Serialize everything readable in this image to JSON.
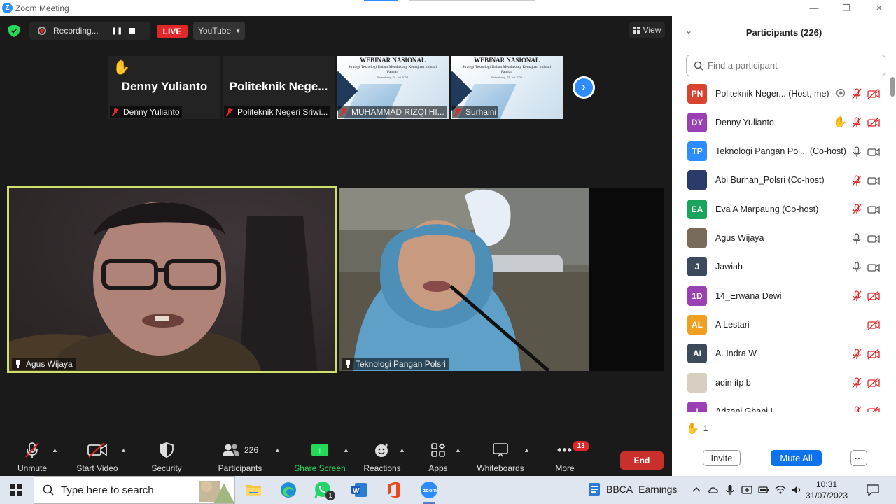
{
  "window": {
    "title": "Zoom Meeting",
    "logo_letter": "Z",
    "minimize": "—",
    "maximize": "❐",
    "close": "✕"
  },
  "topbar": {
    "recording_label": "Recording...",
    "pause_label": "❚❚",
    "live_label": "LIVE",
    "stream_target": "YouTube",
    "view_label": "View"
  },
  "thumbnails": [
    {
      "display_name": "Denny Yulianto",
      "label": "Denny Yulianto",
      "raised_hand": true
    },
    {
      "display_name": "Politeknik  Nege...",
      "label": "Politeknik Negeri Sriwi..."
    },
    {
      "label": "MUHAMMAD RIZQI HI...",
      "slide_title": "WEBINAR NASIONAL",
      "slide_subtitle": "Strategi Teknologi Dalam Mendukung Kemajuan Industri Pangan",
      "slide_date": "Palembang, 31 Juli 2023"
    },
    {
      "label": "Surhaini",
      "slide_title": "WEBINAR NASIONAL",
      "slide_subtitle": "Strategi Teknologi Dalam Mendukung Kemajuan Industri Pangan",
      "slide_date": "Palembang, 31 Juli 2023"
    }
  ],
  "next_arrow": "›",
  "main_videos": [
    {
      "name": "Agus Wijaya"
    },
    {
      "name": "Teknologi Pangan Polsri"
    }
  ],
  "toolbar": {
    "unmute": "Unmute",
    "start_video": "Start Video",
    "security": "Security",
    "participants": "Participants",
    "participants_count": "226",
    "share_screen": "Share Screen",
    "reactions": "Reactions",
    "apps": "Apps",
    "whiteboards": "Whiteboards",
    "more": "More",
    "more_badge": "13",
    "end": "End"
  },
  "panel": {
    "title": "Participants (226)",
    "search_placeholder": "Find a participant",
    "participants": [
      {
        "initials": "PN",
        "color": "#d9432f",
        "name": "Politeknik Neger... (Host, me)",
        "mic": "muted",
        "video": "off",
        "extra": "record"
      },
      {
        "initials": "DY",
        "color": "#9b3fb5",
        "name": "Denny Yulianto",
        "mic": "muted",
        "video": "off",
        "extra": "hand"
      },
      {
        "initials": "TP",
        "color": "#2d8cff",
        "name": "Teknologi Pangan Pol... (Co-host)",
        "mic": "on",
        "video": "on"
      },
      {
        "initials": "",
        "color": "#2a3a6a",
        "name": "Abi Burhan_Polsri (Co-host)",
        "mic": "muted",
        "video": "on",
        "photo": true
      },
      {
        "initials": "EA",
        "color": "#1aa35b",
        "name": "Eva A Marpaung (Co-host)",
        "mic": "muted",
        "video": "on"
      },
      {
        "initials": "",
        "color": "#7a6a5a",
        "name": "Agus Wijaya",
        "mic": "on",
        "video": "on",
        "photo": true
      },
      {
        "initials": "J",
        "color": "#3d4a5c",
        "name": "Jawiah",
        "mic": "on",
        "video": "on"
      },
      {
        "initials": "1D",
        "color": "#9b3fb5",
        "name": "14_Erwana Dewi",
        "mic": "muted",
        "video": "off"
      },
      {
        "initials": "AL",
        "color": "#f0a020",
        "name": "A Lestari",
        "mic": "",
        "video": "off"
      },
      {
        "initials": "AI",
        "color": "#3d4a5c",
        "name": "A. Indra W",
        "mic": "muted",
        "video": "off"
      },
      {
        "initials": "",
        "color": "#d8cfc0",
        "name": "adin itp b",
        "mic": "muted",
        "video": "off",
        "photo": true
      },
      {
        "initials": "I",
        "color": "#9b3fb5",
        "name": "Adzani Ghani I",
        "mic": "muted",
        "video": "off"
      }
    ],
    "raised_hands_count": "1",
    "invite": "Invite",
    "mute_all": "Mute All",
    "more": "···"
  },
  "taskbar": {
    "search_placeholder": "Type here to search",
    "stock_label": "BBCA",
    "stock_status": "Earnings",
    "whatsapp_badge": "1",
    "time": "10:31",
    "date": "31/07/2023"
  }
}
